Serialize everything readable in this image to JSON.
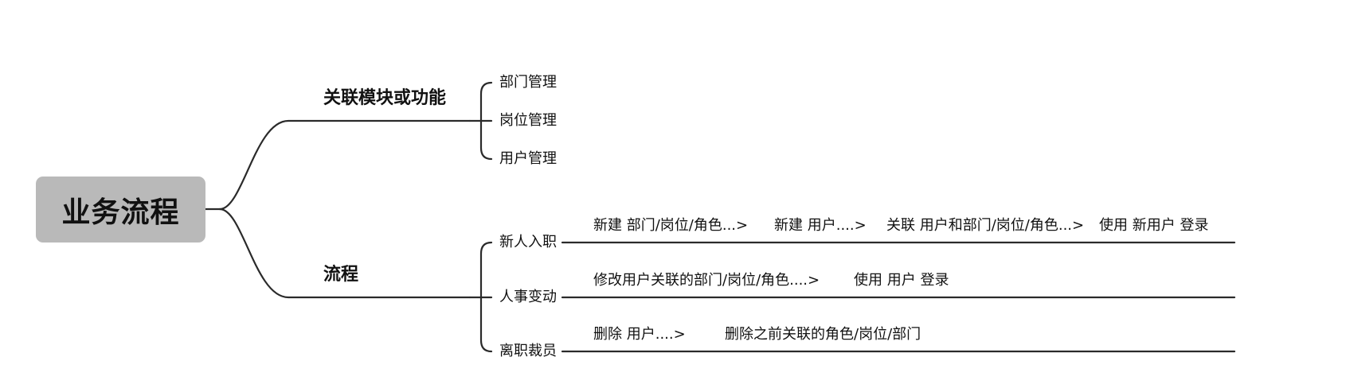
{
  "root": {
    "label": "业务流程"
  },
  "branches": [
    {
      "label": "关联模块或功能",
      "children": [
        {
          "label": "部门管理"
        },
        {
          "label": "岗位管理"
        },
        {
          "label": "用户管理"
        }
      ]
    },
    {
      "label": "流程",
      "children": [
        {
          "label": "新人入职",
          "steps": [
            "新建 部门/岗位/角色...>",
            "新建 用户....>",
            "关联 用户和部门/岗位/角色...>",
            "使用 新用户 登录"
          ]
        },
        {
          "label": "人事变动",
          "steps": [
            "修改用户关联的部门/岗位/角色....>",
            "使用 用户 登录"
          ]
        },
        {
          "label": "离职裁员",
          "steps": [
            "删除 用户....>",
            "删除之前关联的角色/岗位/部门"
          ]
        }
      ]
    }
  ],
  "colors": {
    "root_fill": "#b9b9b9",
    "line": "#2a2a2a",
    "text": "#111111"
  }
}
